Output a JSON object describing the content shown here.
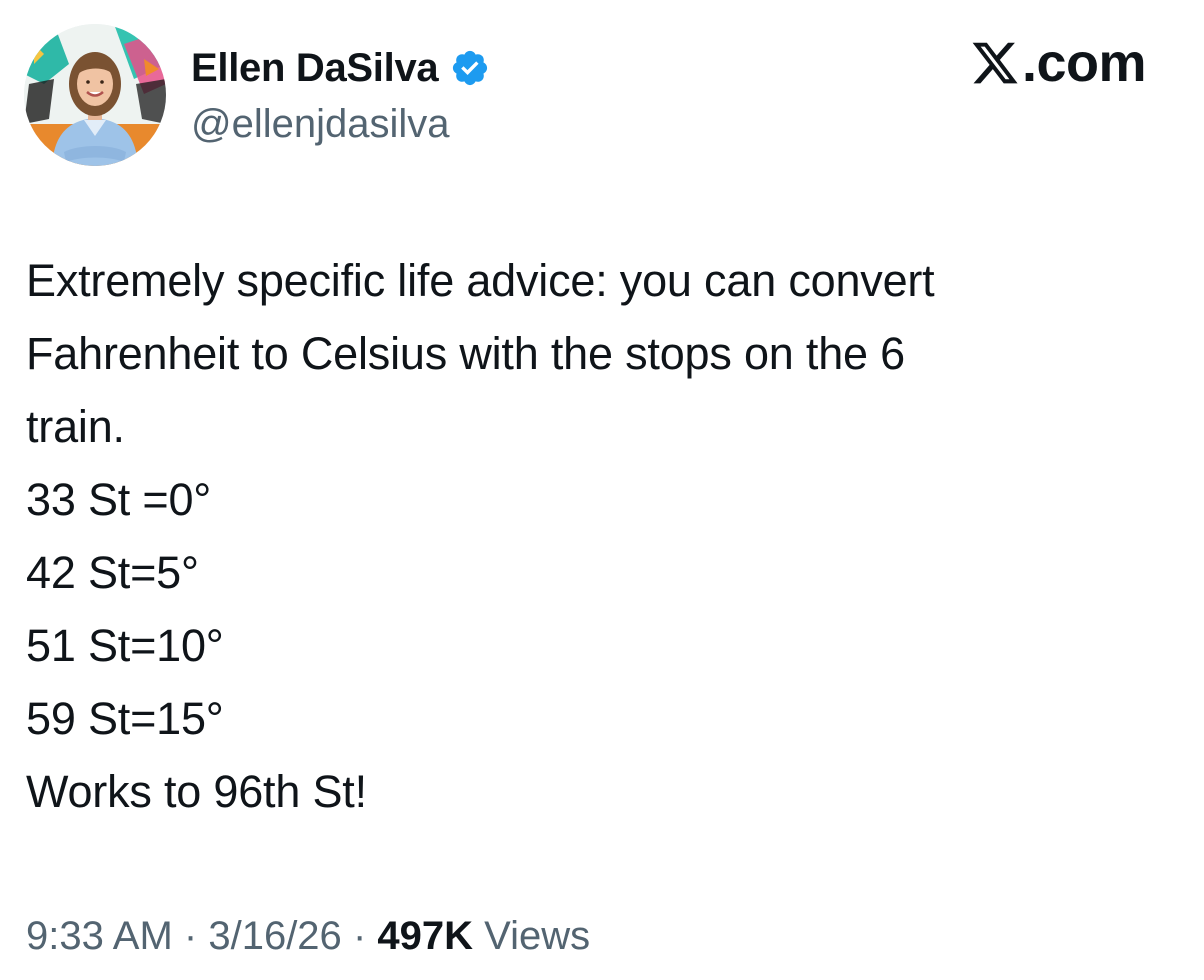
{
  "author": {
    "name": "Ellen DaSilva",
    "handle": "@ellenjdasilva",
    "verified": true,
    "verified_color": "#1d9bf0"
  },
  "brand": {
    "text": ".com",
    "logo_icon": "x-logo-icon"
  },
  "tweet": {
    "lines": [
      "Extremely specific life advice: you can convert",
      "Fahrenheit to Celsius with the stops on the 6",
      "train.",
      "33 St =0°",
      "42 St=5°",
      "51 St=10°",
      "59 St=15°",
      "Works to 96th St!"
    ]
  },
  "meta": {
    "time": "9:33 AM",
    "date": "3/16/26",
    "separator": "·",
    "views_count": "497K",
    "views_label": "Views"
  },
  "colors": {
    "text": "#0f1419",
    "secondary": "#536471",
    "background": "#ffffff"
  }
}
